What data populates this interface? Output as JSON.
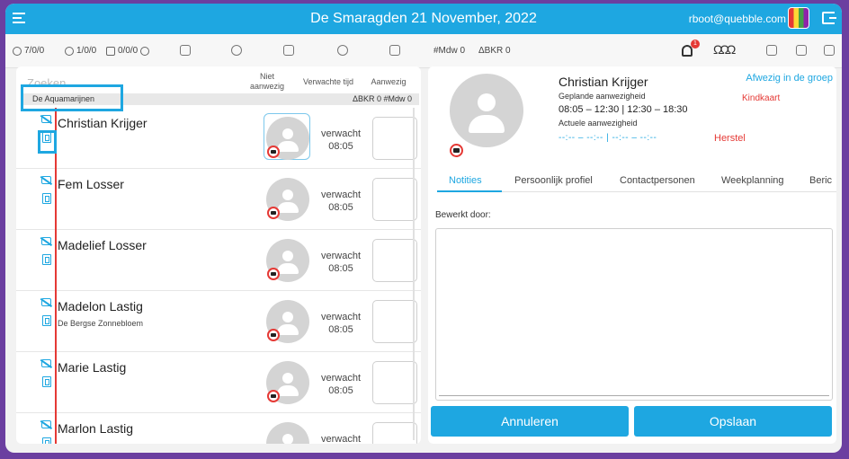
{
  "header": {
    "title": "De Smaragden 21 November, 2022",
    "user": "rboot@quebble.com"
  },
  "toolbar": {
    "count_a": "7/0/0",
    "count_b": "1/0/0",
    "count_c": "0/0/0",
    "mdw": "#Mdw 0",
    "bkr": "ΔBKR 0",
    "notifications": "1"
  },
  "list": {
    "search_placeholder": "Zoeken",
    "col_absent": "Niet aanwezig",
    "col_expected": "Verwachte tijd",
    "col_present": "Aanwezig",
    "group": {
      "name": "De Aquamarijnen",
      "stats": "ΔBKR 0 #Mdw 0"
    },
    "children": [
      {
        "name": "Christian Krijger",
        "sub": "",
        "status": "verwacht",
        "time": "08:05"
      },
      {
        "name": "Fem Losser",
        "sub": "",
        "status": "verwacht",
        "time": "08:05"
      },
      {
        "name": "Madelief Losser",
        "sub": "",
        "status": "verwacht",
        "time": "08:05"
      },
      {
        "name": "Madelon Lastig",
        "sub": "De Bergse Zonnebloem",
        "status": "verwacht",
        "time": "08:05"
      },
      {
        "name": "Marie Lastig",
        "sub": "",
        "status": "verwacht",
        "time": "08:05"
      },
      {
        "name": "Marlon Lastig",
        "sub": "",
        "status": "verwacht",
        "time": ""
      }
    ]
  },
  "detail": {
    "name": "Christian Krijger",
    "planned_label": "Geplande aanwezigheid",
    "planned_value": "08:05 – 12:30 | 12:30 – 18:30",
    "actual_label": "Actuele aanwezigheid",
    "actual_value": "--:-- – --:-- | --:-- – --:--",
    "restore": "Herstel",
    "absent_link": "Afwezig in de groep",
    "child_card": "Kindkaart",
    "tabs": [
      "Notities",
      "Persoonlijk profiel",
      "Contactpersonen",
      "Weekplanning",
      "Beric"
    ],
    "edited_by": "Bewerkt door:",
    "cancel": "Annuleren",
    "save": "Opslaan"
  },
  "colors": {
    "accent": "#1ea7e1",
    "alert": "#e53935",
    "frame": "#6b3fa0"
  }
}
